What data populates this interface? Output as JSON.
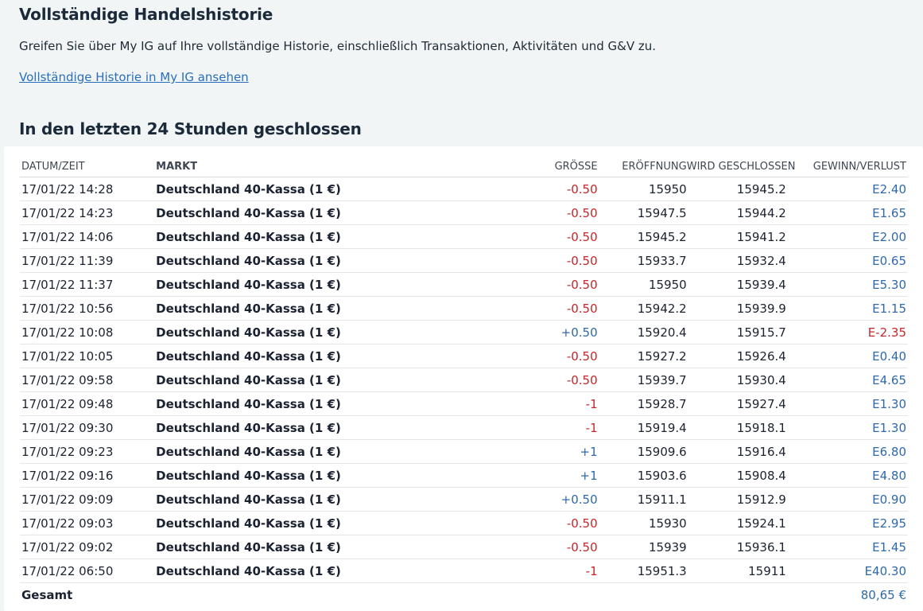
{
  "header": {
    "title": "Vollständige Handelshistorie",
    "description": "Greifen Sie über My IG auf Ihre vollständige Historie, einschließlich Transaktionen, Aktivitäten und G&V zu.",
    "link": "Vollständige Historie in My IG ansehen"
  },
  "closed_section": {
    "title": "In den letzten 24 Stunden geschlossen"
  },
  "table": {
    "columns": {
      "date": "DATUM/ZEIT",
      "market": "MARKT",
      "size": "GRÖSSE",
      "open": "ERÖFFNUNG",
      "close": "WIRD GESCHLOSSEN",
      "pl": "GEWINN/VERLUST"
    },
    "rows": [
      {
        "date": "17/01/22 14:28",
        "market": "Deutschland 40-Kassa (1 €)",
        "size": "-0.50",
        "open": "15950",
        "close": "15945.2",
        "pl": "E2.40"
      },
      {
        "date": "17/01/22 14:23",
        "market": "Deutschland 40-Kassa (1 €)",
        "size": "-0.50",
        "open": "15947.5",
        "close": "15944.2",
        "pl": "E1.65"
      },
      {
        "date": "17/01/22 14:06",
        "market": "Deutschland 40-Kassa (1 €)",
        "size": "-0.50",
        "open": "15945.2",
        "close": "15941.2",
        "pl": "E2.00"
      },
      {
        "date": "17/01/22 11:39",
        "market": "Deutschland 40-Kassa (1 €)",
        "size": "-0.50",
        "open": "15933.7",
        "close": "15932.4",
        "pl": "E0.65"
      },
      {
        "date": "17/01/22 11:37",
        "market": "Deutschland 40-Kassa (1 €)",
        "size": "-0.50",
        "open": "15950",
        "close": "15939.4",
        "pl": "E5.30"
      },
      {
        "date": "17/01/22 10:56",
        "market": "Deutschland 40-Kassa (1 €)",
        "size": "-0.50",
        "open": "15942.2",
        "close": "15939.9",
        "pl": "E1.15"
      },
      {
        "date": "17/01/22 10:08",
        "market": "Deutschland 40-Kassa (1 €)",
        "size": "+0.50",
        "open": "15920.4",
        "close": "15915.7",
        "pl": "E-2.35"
      },
      {
        "date": "17/01/22 10:05",
        "market": "Deutschland 40-Kassa (1 €)",
        "size": "-0.50",
        "open": "15927.2",
        "close": "15926.4",
        "pl": "E0.40"
      },
      {
        "date": "17/01/22 09:58",
        "market": "Deutschland 40-Kassa (1 €)",
        "size": "-0.50",
        "open": "15939.7",
        "close": "15930.4",
        "pl": "E4.65"
      },
      {
        "date": "17/01/22 09:48",
        "market": "Deutschland 40-Kassa (1 €)",
        "size": "-1",
        "open": "15928.7",
        "close": "15927.4",
        "pl": "E1.30"
      },
      {
        "date": "17/01/22 09:30",
        "market": "Deutschland 40-Kassa (1 €)",
        "size": "-1",
        "open": "15919.4",
        "close": "15918.1",
        "pl": "E1.30"
      },
      {
        "date": "17/01/22 09:23",
        "market": "Deutschland 40-Kassa (1 €)",
        "size": "+1",
        "open": "15909.6",
        "close": "15916.4",
        "pl": "E6.80"
      },
      {
        "date": "17/01/22 09:16",
        "market": "Deutschland 40-Kassa (1 €)",
        "size": "+1",
        "open": "15903.6",
        "close": "15908.4",
        "pl": "E4.80"
      },
      {
        "date": "17/01/22 09:09",
        "market": "Deutschland 40-Kassa (1 €)",
        "size": "+0.50",
        "open": "15911.1",
        "close": "15912.9",
        "pl": "E0.90"
      },
      {
        "date": "17/01/22 09:03",
        "market": "Deutschland 40-Kassa (1 €)",
        "size": "-0.50",
        "open": "15930",
        "close": "15924.1",
        "pl": "E2.95"
      },
      {
        "date": "17/01/22 09:02",
        "market": "Deutschland 40-Kassa (1 €)",
        "size": "-0.50",
        "open": "15939",
        "close": "15936.1",
        "pl": "E1.45"
      },
      {
        "date": "17/01/22 06:50",
        "market": "Deutschland 40-Kassa (1 €)",
        "size": "-1",
        "open": "15951.3",
        "close": "15911",
        "pl": "E40.30"
      }
    ],
    "total": {
      "label": "Gesamt",
      "value": "80,65 €"
    }
  },
  "colors": {
    "background": "#f1f5f5",
    "negative": "#c8262a",
    "positive": "#2e69a9",
    "link": "#2a6fbe"
  }
}
